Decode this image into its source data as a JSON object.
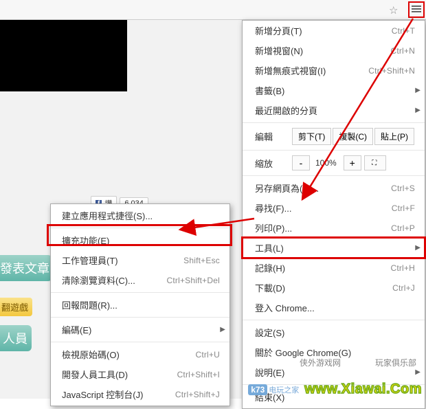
{
  "toolbar": {
    "star": "☆",
    "menu": "≡"
  },
  "page": {
    "fb_like_label": "讚",
    "fb_count": "6,034",
    "side1": "發表文章",
    "side2": "翻遊戲",
    "side3": "人員"
  },
  "mainmenu": {
    "new_tab": {
      "label": "新增分頁(T)",
      "shortcut": "Ctrl+T"
    },
    "new_window": {
      "label": "新增視窗(N)",
      "shortcut": "Ctrl+N"
    },
    "incognito": {
      "label": "新增無痕式視窗(I)",
      "shortcut": "Ctrl+Shift+N"
    },
    "bookmarks": {
      "label": "書籤(B)"
    },
    "recent_tabs": {
      "label": "最近開啟的分頁"
    },
    "edit_lbl": "編輯",
    "cut": "剪下(T)",
    "copy": "複製(C)",
    "paste": "貼上(P)",
    "zoom_lbl": "縮放",
    "zoom_minus": "-",
    "zoom_val": "100%",
    "zoom_plus": "+",
    "save_as": {
      "label": "另存網頁為(A)...",
      "shortcut": "Ctrl+S"
    },
    "find": {
      "label": "尋找(F)...",
      "shortcut": "Ctrl+F"
    },
    "print": {
      "label": "列印(P)...",
      "shortcut": "Ctrl+P"
    },
    "tools": {
      "label": "工具(L)"
    },
    "history": {
      "label": "記錄(H)",
      "shortcut": "Ctrl+H"
    },
    "downloads": {
      "label": "下載(D)",
      "shortcut": "Ctrl+J"
    },
    "signin": {
      "label": "登入 Chrome..."
    },
    "settings": {
      "label": "設定(S)"
    },
    "about": {
      "label": "關於 Google Chrome(G)"
    },
    "help": {
      "label": "說明(E)"
    },
    "exit": {
      "label": "結束(X)"
    }
  },
  "submenu": {
    "create_shortcut": {
      "label": "建立應用程式捷徑(S)..."
    },
    "extensions": {
      "label": "擴充功能(E)"
    },
    "task_manager": {
      "label": "工作管理員(T)",
      "shortcut": "Shift+Esc"
    },
    "clear_data": {
      "label": "清除瀏覽資料(C)...",
      "shortcut": "Ctrl+Shift+Del"
    },
    "report_issue": {
      "label": "回報問題(R)..."
    },
    "encoding": {
      "label": "編碼(E)"
    },
    "view_source": {
      "label": "檢視原始碼(O)",
      "shortcut": "Ctrl+U"
    },
    "dev_tools": {
      "label": "開發人員工具(D)",
      "shortcut": "Ctrl+Shift+I"
    },
    "js_console": {
      "label": "JavaScript 控制台(J)",
      "shortcut": "Ctrl+Shift+J"
    }
  },
  "watermark": {
    "top_left": "侠外游戏网",
    "top_right": "玩家俱乐部",
    "k73": "k73",
    "k73_sub": "电玩之家",
    "xiawai": "www.Xiawai.Com"
  }
}
